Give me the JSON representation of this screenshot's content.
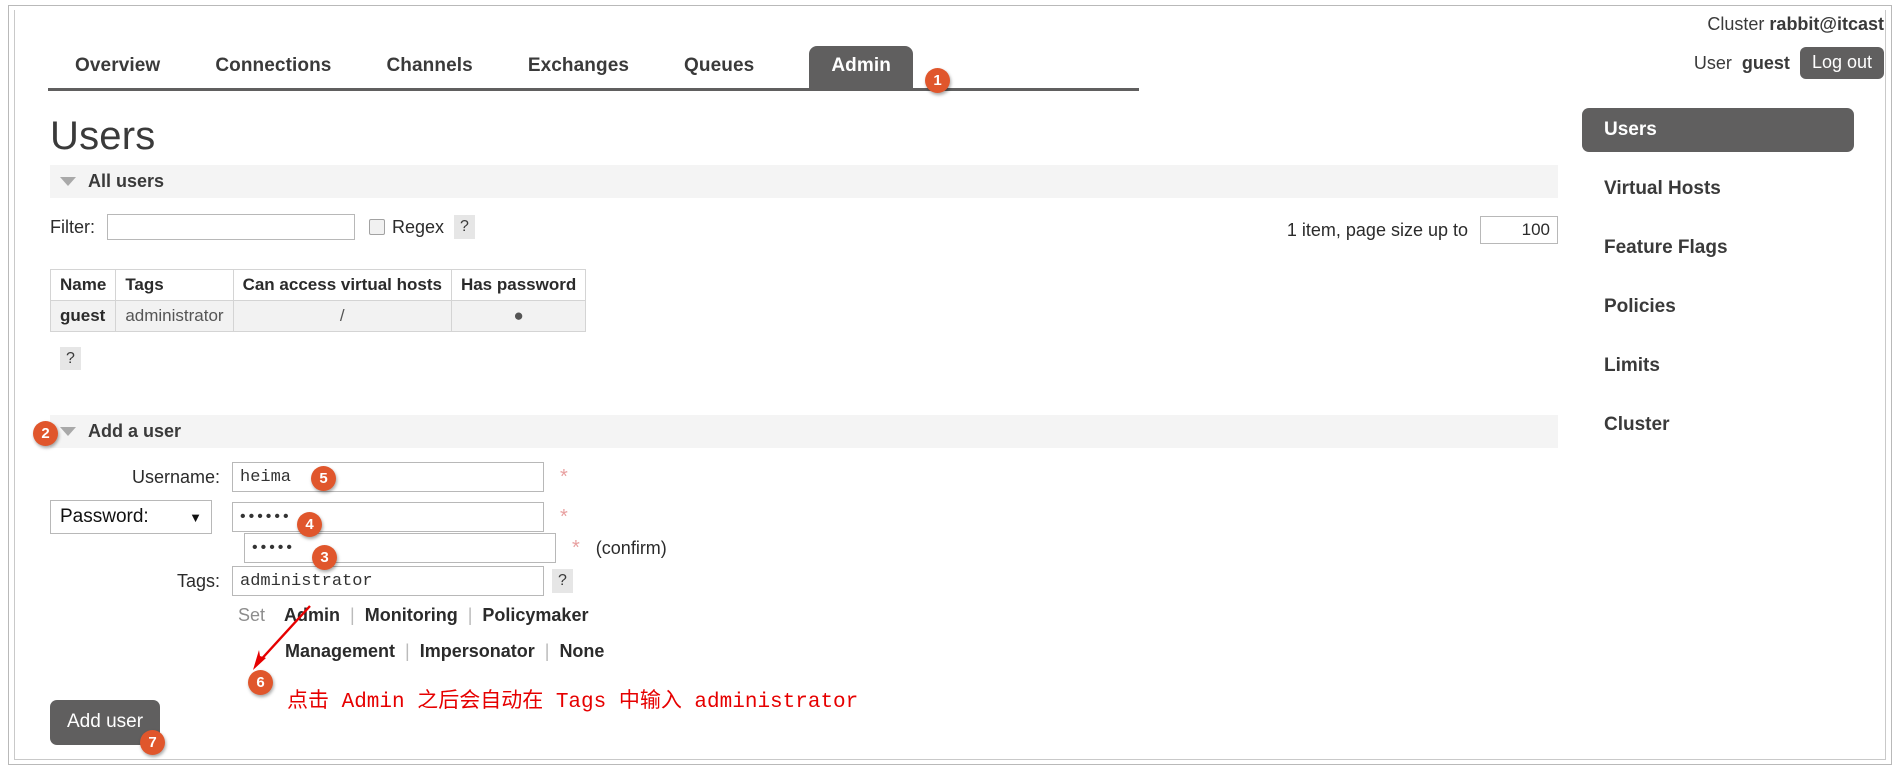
{
  "header": {
    "cluster_label": "Cluster",
    "cluster_name": "rabbit@itcast",
    "user_label": "User",
    "user_name": "guest",
    "logout_label": "Log out"
  },
  "nav": {
    "items": [
      {
        "label": "Overview",
        "active": false
      },
      {
        "label": "Connections",
        "active": false
      },
      {
        "label": "Channels",
        "active": false
      },
      {
        "label": "Exchanges",
        "active": false
      },
      {
        "label": "Queues",
        "active": false
      },
      {
        "label": "Admin",
        "active": true
      }
    ]
  },
  "page": {
    "title": "Users"
  },
  "all_users": {
    "section_label": "All users",
    "filter_label": "Filter:",
    "filter_value": "",
    "filter_placeholder": "",
    "regex_label": "Regex",
    "help_label": "?",
    "page_info": "1 item, page size up to",
    "page_size_value": "100",
    "columns": [
      "Name",
      "Tags",
      "Can access virtual hosts",
      "Has password"
    ],
    "rows": [
      {
        "name": "guest",
        "tags": "administrator",
        "vhosts": "/",
        "has_password": "●"
      }
    ],
    "table_help_label": "?"
  },
  "add_user": {
    "section_label": "Add a user",
    "username_label": "Username:",
    "username_value": "heima",
    "password_select_label": "Password:",
    "password_select_caret": "▼",
    "password_value": "••••••",
    "password_confirm_value": "•••••",
    "confirm_note": "(confirm)",
    "required_star": "*",
    "tags_label": "Tags:",
    "tags_value": "administrator",
    "tags_help_label": "?",
    "set_label": "Set",
    "tag_presets_row1": [
      "Admin",
      "Monitoring",
      "Policymaker"
    ],
    "tag_presets_row2": [
      "Management",
      "Impersonator",
      "None"
    ],
    "tag_separator": "|",
    "submit_label": "Add user"
  },
  "annotation": {
    "note_text": "点击 Admin 之后会自动在 Tags 中输入 administrator",
    "note_color": "#e60000",
    "badge_color": "#e0562c",
    "badges": [
      "1",
      "2",
      "3",
      "4",
      "5",
      "6",
      "7"
    ]
  },
  "sidebar": {
    "items": [
      {
        "label": "Users",
        "active": true
      },
      {
        "label": "Virtual Hosts",
        "active": false
      },
      {
        "label": "Feature Flags",
        "active": false
      },
      {
        "label": "Policies",
        "active": false
      },
      {
        "label": "Limits",
        "active": false
      },
      {
        "label": "Cluster",
        "active": false
      }
    ]
  },
  "colors": {
    "accent_dark": "#605f5f",
    "section_bg": "#f4f4f4",
    "badge_orange": "#e0562c",
    "annotation_red": "#e60000"
  }
}
